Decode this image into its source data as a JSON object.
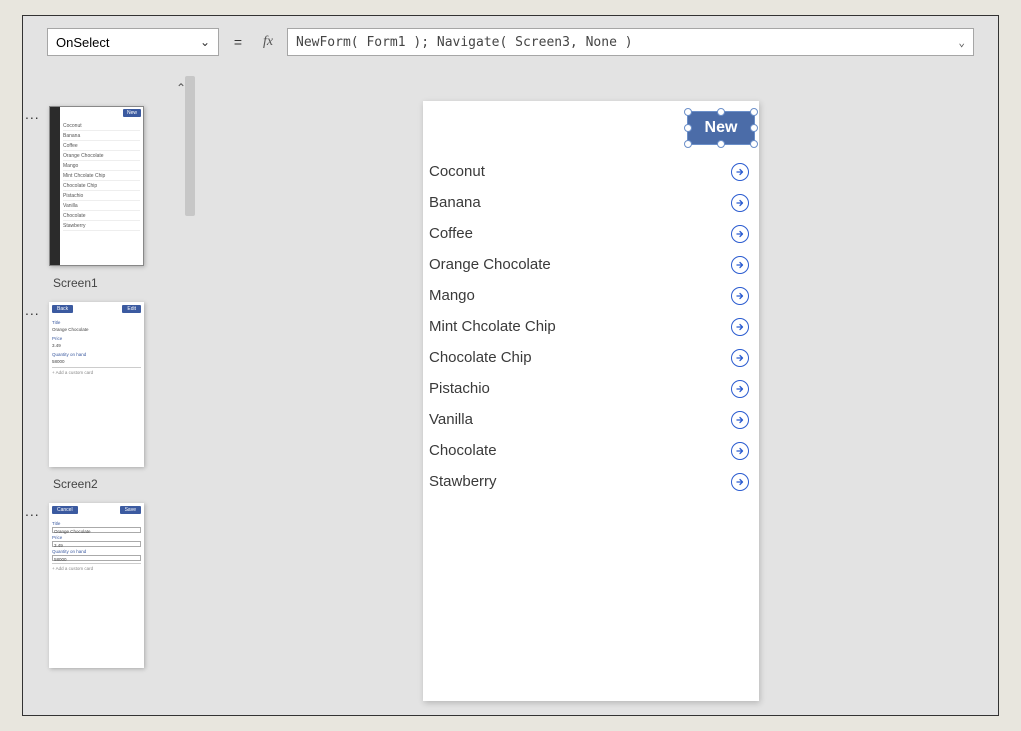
{
  "formula": {
    "property": "OnSelect",
    "expression": "NewForm( Form1 ); Navigate( Screen3, None )"
  },
  "screens": {
    "list": [
      {
        "label": "Screen1"
      },
      {
        "label": "Screen2"
      }
    ]
  },
  "app": {
    "new_button": "New",
    "items": [
      "Coconut",
      "Banana",
      "Coffee",
      "Orange Chocolate",
      "Mango",
      "Mint Chcolate Chip",
      "Chocolate Chip",
      "Pistachio",
      "Vanilla",
      "Chocolate",
      "Stawberry"
    ]
  },
  "thumb2": {
    "back": "Back",
    "edit": "Edit",
    "fields": {
      "title_lbl": "Title",
      "title_val": "Orange Chocolate",
      "price_lbl": "Price",
      "price_val": "3.49",
      "qty_lbl": "Quantity on hand",
      "qty_val": "58000",
      "add": "+  Add a custom card"
    }
  },
  "thumb3": {
    "cancel": "Cancel",
    "save": "Save",
    "fields": {
      "title_lbl": "Title",
      "title_val": "Orange Chocolate",
      "price_lbl": "Price",
      "price_val": "3.49",
      "qty_lbl": "Quantity on hand",
      "qty_val": "58000",
      "add": "+  Add a custom card"
    }
  },
  "thumb1_new": "New"
}
